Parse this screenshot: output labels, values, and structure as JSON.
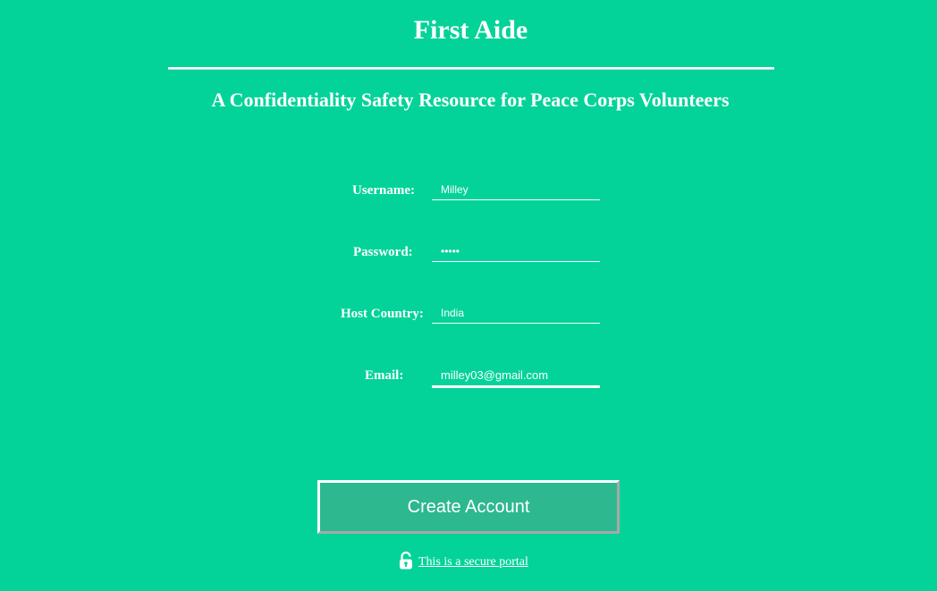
{
  "header": {
    "title": "First Aide",
    "subtitle": "A Confidentiality Safety Resource for Peace Corps Volunteers"
  },
  "form": {
    "username": {
      "label": "Username:",
      "value": "Milley"
    },
    "password": {
      "label": "Password:",
      "value": "•••••"
    },
    "host_country": {
      "label": "Host Country:",
      "value": "India"
    },
    "email": {
      "label": "Email:",
      "value": "milley03@gmail.com"
    }
  },
  "actions": {
    "create_account_label": "Create Account"
  },
  "footer": {
    "secure_portal_text": "This is a secure portal",
    "lock_icon": "unlocked-padlock-icon"
  },
  "colors": {
    "background": "#04d399",
    "button_background": "#2db890",
    "text": "#ffffff"
  }
}
